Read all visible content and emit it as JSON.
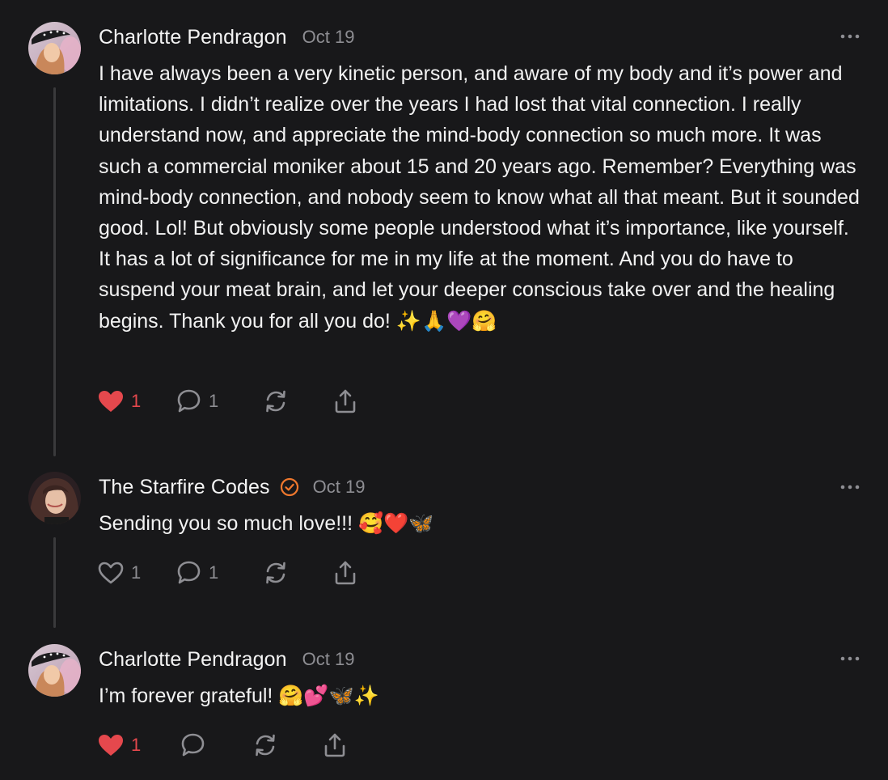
{
  "comments": [
    {
      "author": "Charlotte Pendragon",
      "date": "Oct 19",
      "verified": false,
      "text": "I have always been a very kinetic person, and aware of my body and it’s power and limitations. I didn’t realize over the years I had lost that vital connection. I really understand now, and appreciate the mind-body connection so much more. It was such a commercial moniker about 15 and 20 years ago. Remember? Everything was mind-body connection, and nobody seem to know what all that meant. But it sounded good. Lol! But obviously some people understood what it’s importance, like yourself. It has a lot of significance for me in my life at the moment. And you do have to suspend your meat brain, and let your deeper conscious take over and the healing begins. Thank you for all you do! ✨🙏💜🤗",
      "likes": "1",
      "liked": true,
      "replies": "1"
    },
    {
      "author": "The Starfire Codes",
      "date": "Oct 19",
      "verified": true,
      "text": "Sending you so much love!!! 🥰❤️🦋",
      "likes": "1",
      "liked": false,
      "replies": "1"
    },
    {
      "author": "Charlotte Pendragon",
      "date": "Oct 19",
      "verified": false,
      "text": "I’m forever grateful! 🤗💕🦋✨",
      "likes": "1",
      "liked": true,
      "replies": ""
    }
  ],
  "colors": {
    "background": "#18181a",
    "liked_heart": "#e5484d",
    "muted": "#8e8e93",
    "verified_badge": "#f0782d",
    "thread_line": "#3a3a3c"
  },
  "icons": {
    "like": "heart-icon",
    "reply": "speech-bubble-icon",
    "restack": "restack-arrows-icon",
    "share": "share-upload-icon",
    "more": "ellipsis-icon",
    "verified": "verified-check-badge-icon"
  }
}
